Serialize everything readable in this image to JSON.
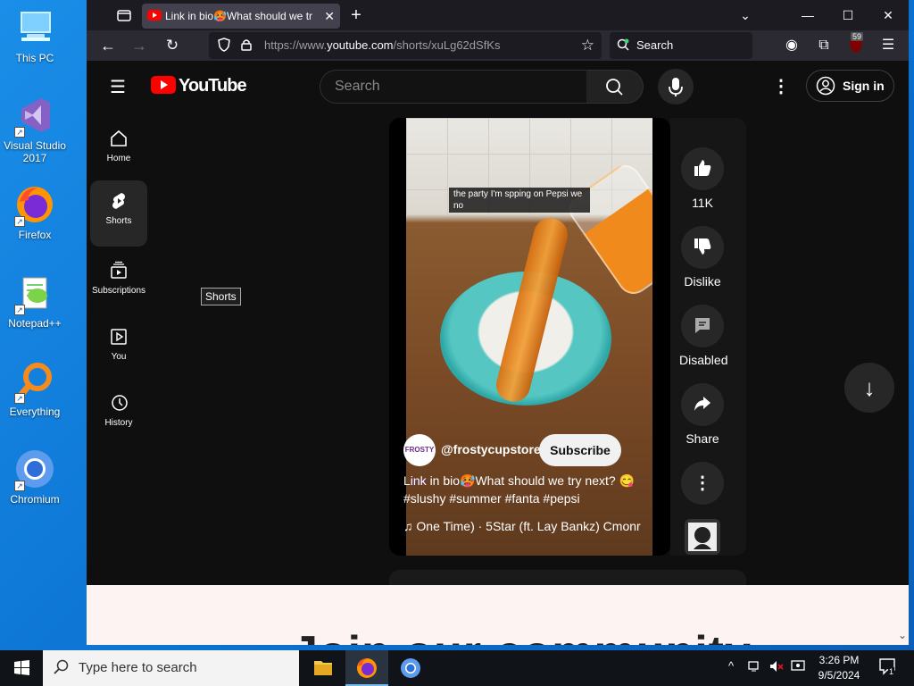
{
  "desktop": {
    "icons": [
      {
        "label": "This PC"
      },
      {
        "label": "Visual Studio 2017"
      },
      {
        "label": "Firefox"
      },
      {
        "label": "Notepad++"
      },
      {
        "label": "Everything"
      },
      {
        "label": "Chromium"
      }
    ]
  },
  "browser": {
    "tab_title": "Link in bio🥵What should we tr",
    "url_prefix": "https://www.",
    "url_domain": "youtube.com",
    "url_path": "/shorts/xuLg62dSfKs",
    "search_placeholder": "Search",
    "extension_badge": "59"
  },
  "youtube": {
    "logo_text": "YouTube",
    "search_placeholder": "Search",
    "signin_label": "Sign in",
    "sidebar": [
      {
        "label": "Home"
      },
      {
        "label": "Shorts"
      },
      {
        "label": "Subscriptions"
      },
      {
        "label": "You"
      },
      {
        "label": "History"
      }
    ],
    "tooltip": "Shorts",
    "video": {
      "caption": "the party I'm spping on Pepsi we no",
      "channel_avatar_text": "FROSTY CUP",
      "channel": "@frostycupstore",
      "subscribe_label": "Subscribe",
      "title": "Link in bio🥵What should we try next? 😋 #slushy #summer #fanta #pepsi",
      "music": "♫ One Time) · 5Star (ft. Lay Bankz)     Cmonr"
    },
    "actions": {
      "like_count": "11K",
      "dislike_label": "Dislike",
      "comments_label": "Disabled",
      "share_label": "Share"
    },
    "community_text": "Join our community"
  },
  "taskbar": {
    "search_placeholder": "Type here to search",
    "time": "3:26 PM",
    "date": "9/5/2024",
    "notification_count": "1"
  }
}
